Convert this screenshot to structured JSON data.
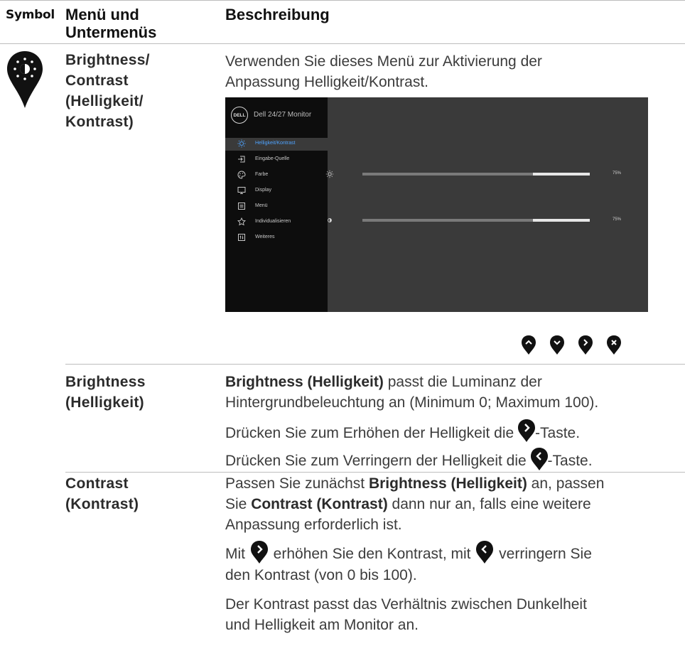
{
  "header": {
    "symbol": "Symbol",
    "menu": "Menü und Untermenüs",
    "menu_line1": "Menü und",
    "menu_line2": "Untermenüs",
    "description": "Beschreibung"
  },
  "row_main": {
    "icon": "brightness-pin-icon",
    "title_lines": [
      "Brightness/",
      "Contrast",
      "(Helligkeit/",
      "Kontrast)"
    ],
    "desc_lines": [
      "Verwenden Sie dieses Menü zur Aktivierung der",
      "Anpassung Helligkeit/Kontrast."
    ]
  },
  "osd": {
    "logo": "DELL",
    "title": "Dell 24/27 Monitor",
    "menu_items": [
      {
        "label": "Helligkeit/Kontrast",
        "icon": "brightness-icon",
        "selected": true
      },
      {
        "label": "Eingabe-Quelle",
        "icon": "input-source-icon",
        "selected": false
      },
      {
        "label": "Farbe",
        "icon": "color-icon",
        "selected": false
      },
      {
        "label": "Display",
        "icon": "display-icon",
        "selected": false
      },
      {
        "label": "Menü",
        "icon": "menu-icon",
        "selected": false
      },
      {
        "label": "Individualisieren",
        "icon": "star-icon",
        "selected": false
      },
      {
        "label": "Weiteres",
        "icon": "others-icon",
        "selected": false
      }
    ],
    "brightness": {
      "value": 75,
      "label": "75%",
      "icon": "sun-icon"
    },
    "contrast": {
      "value": 75,
      "label": "75%",
      "icon": "contrast-icon"
    },
    "colors": {
      "panel": "#3a3a3a",
      "sidebar": "#0d0d0d",
      "selected_text": "#4fa3ff"
    }
  },
  "nav_buttons": [
    "up-pin-icon",
    "down-pin-icon",
    "right-pin-icon",
    "close-pin-icon"
  ],
  "row_brightness": {
    "title_lines": [
      "Brightness",
      "(Helligkeit)"
    ],
    "p1_bold": "Brightness (Helligkeit)",
    "p1_rest_line1": " passt die Luminanz der",
    "p1_line2": "Hintergrundbeleuchtung an (Minimum 0; Maximum 100).",
    "p2_before": "Drücken Sie zum Erhöhen der Helligkeit die ",
    "p2_after": "-Taste.",
    "p3_before": "Drücken Sie zum Verringern der Helligkeit die ",
    "p3_after": "-Taste."
  },
  "row_contrast": {
    "title_lines": [
      "Contrast",
      "(Kontrast)"
    ],
    "p1_a": "Passen Sie zunächst ",
    "p1_b_bold": "Brightness (Helligkeit)",
    "p1_c": " an, passen",
    "p1_d": "Sie ",
    "p1_e_bold": "Contrast (Kontrast)",
    "p1_f": " dann nur an, falls eine weitere",
    "p1_g": "Anpassung erforderlich ist.",
    "p2_a": "Mit ",
    "p2_b": " erhöhen Sie den Kontrast, mit ",
    "p2_c": " verringern Sie",
    "p2_d": "den Kontrast (von 0 bis 100).",
    "p3_line1": "Der Kontrast passt das Verhältnis zwischen Dunkelheit",
    "p3_line2": "und Helligkeit am Monitor an."
  }
}
